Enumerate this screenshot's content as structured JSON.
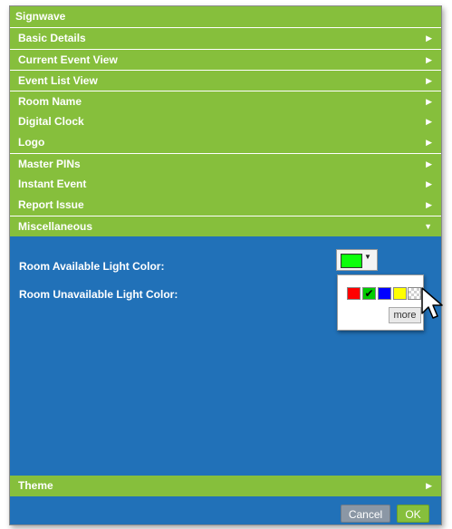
{
  "window": {
    "title": "Signwave"
  },
  "sections": [
    {
      "label": "Basic Details",
      "arrow": "▶"
    },
    {
      "label": "Current Event View",
      "arrow": "▶"
    },
    {
      "label": "Event List View",
      "arrow": "▶"
    },
    {
      "label": "Room Name",
      "arrow": "▶"
    },
    {
      "label": "Digital Clock",
      "arrow": "▶"
    },
    {
      "label": "Logo",
      "arrow": "▶"
    },
    {
      "label": "Master PINs",
      "arrow": "▶"
    },
    {
      "label": "Instant Event",
      "arrow": "▶"
    },
    {
      "label": "Report Issue",
      "arrow": "▶"
    },
    {
      "label": "Miscellaneous",
      "arrow": "▼"
    }
  ],
  "miscellaneous": {
    "available_light_label": "Room Available Light Color:",
    "unavailable_light_label": "Room Unavailable Light Color:",
    "available_color": "#0cff0c",
    "dropdown_arrow": "▼"
  },
  "palette": {
    "colors": [
      "#ff0000",
      "#00cc00",
      "#0000ff",
      "#ffff00"
    ],
    "selected_index": 1,
    "check_mark": "✔",
    "more_label": "more"
  },
  "theme": {
    "label": "Theme",
    "arrow": "▶"
  },
  "footer": {
    "cancel_label": "Cancel",
    "ok_label": "OK"
  },
  "colors": {
    "header_green": "#86bf3c",
    "panel_blue": "#2171b8",
    "cancel_gray": "#8b97a5"
  }
}
